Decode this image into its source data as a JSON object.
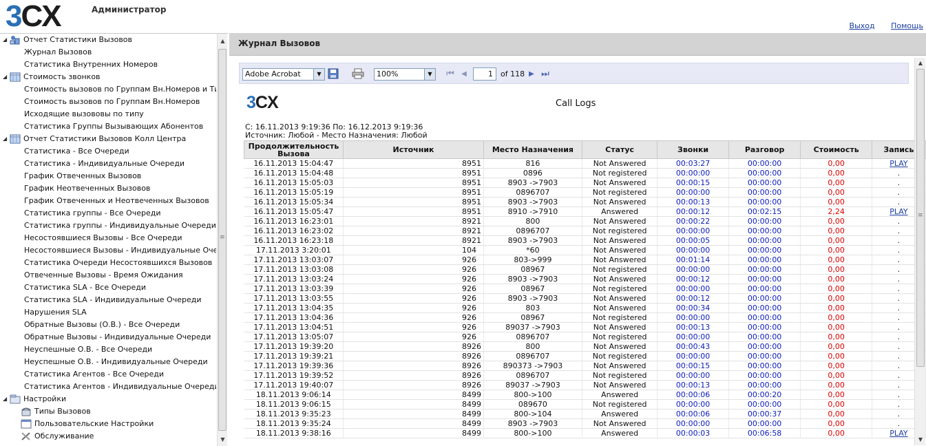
{
  "header": {
    "logo_3": "3",
    "logo_cx": "CX",
    "title": "Администратор",
    "logout": "Выход",
    "help": "Помощь"
  },
  "sidebar": {
    "items": [
      {
        "type": "group",
        "label": "Отчет Статистики Вызовов",
        "icon": "reports-icon"
      },
      {
        "type": "leaf",
        "label": "Журнал Вызовов"
      },
      {
        "type": "leaf",
        "label": "Статистика Внутренних Номеров"
      },
      {
        "type": "group",
        "label": "Стоимость звонков",
        "icon": "table-icon"
      },
      {
        "type": "leaf",
        "label": "Стоимость вызовов по Группам Вн.Номеров и Типам"
      },
      {
        "type": "leaf",
        "label": "Стоимость вызовов по Группам Вн.Номеров"
      },
      {
        "type": "leaf",
        "label": "Исходящие вызововы по типу"
      },
      {
        "type": "leaf",
        "label": "Статистика Группы Вызывающих Абонентов"
      },
      {
        "type": "group",
        "label": "Отчет Статистики Вызовов Колл Центра",
        "icon": "table-icon"
      },
      {
        "type": "leaf",
        "label": "Статистика - Все Очереди"
      },
      {
        "type": "leaf",
        "label": "Статистика - Индивидуальные Очереди"
      },
      {
        "type": "leaf",
        "label": "График Отвеченных Вызовов"
      },
      {
        "type": "leaf",
        "label": "График Неотвеченных Вызовов"
      },
      {
        "type": "leaf",
        "label": "График Отвеченных и Неотвеченных Вызовов"
      },
      {
        "type": "leaf",
        "label": "Статистика группы - Все Очереди"
      },
      {
        "type": "leaf",
        "label": "Статистика группы - Индивидуальные Очереди"
      },
      {
        "type": "leaf",
        "label": "Несостоявшиеся Вызовы - Все Очереди"
      },
      {
        "type": "leaf",
        "label": "Несостоявшиеся Вызовы - Индивидуальные Очереди"
      },
      {
        "type": "leaf",
        "label": "Статистика Очереди Несостоявшихся Вызовов"
      },
      {
        "type": "leaf",
        "label": "Отвеченные Вызовы - Время Ожидания"
      },
      {
        "type": "leaf",
        "label": "Статистика SLA - Все Очереди"
      },
      {
        "type": "leaf",
        "label": "Статистика SLA - Индивидуальные Очереди"
      },
      {
        "type": "leaf",
        "label": "Нарушения SLA"
      },
      {
        "type": "leaf",
        "label": "Обратные Вызовы (О.В.) - Все Очереди"
      },
      {
        "type": "leaf",
        "label": "Обратные Вызовы - Индивидуальные Очереди"
      },
      {
        "type": "leaf",
        "label": "Неуспешные О.В. - Все  Очереди"
      },
      {
        "type": "leaf",
        "label": "Неуспешные О.В. - Индивидуальные  Очереди"
      },
      {
        "type": "leaf",
        "label": "Статистика Агентов - Все Очереди"
      },
      {
        "type": "leaf",
        "label": "Статистика Агентов - Индивидуальные Очереди"
      },
      {
        "type": "group",
        "label": "Настройки",
        "icon": "settings-icon"
      },
      {
        "type": "subgroup",
        "label": "Типы Вызовов",
        "icon": "phone-icon"
      },
      {
        "type": "subgroup",
        "label": "Пользовательские Настройки",
        "icon": "window-icon"
      },
      {
        "type": "subgroup",
        "label": "Обслуживание",
        "icon": "tools-icon"
      }
    ]
  },
  "main": {
    "title": "Журнал Вызовов",
    "toolbar": {
      "format": "Adobe Acrobat",
      "zoom": "100%",
      "page": "1",
      "of_label": "of 118"
    },
    "report": {
      "title": "Call Logs",
      "range": "С: 16.11.2013 9:19:36 По: 16.12.2013 9:19:36",
      "filter": "Источник: Любой - Место Назначения: Любой",
      "columns": [
        "Продолжительность Вызова",
        "Источник",
        "Место Назначения",
        "Статус",
        "Звонки",
        "Разговор",
        "Стоимость",
        "Запись"
      ],
      "rows": [
        [
          "16.11.2013 15:04:47",
          "8951",
          "816",
          "Not Answered",
          "00:03:27",
          "00:00:00",
          "0,00",
          "PLAY"
        ],
        [
          "16.11.2013 15:04:48",
          "8951",
          "0896",
          "Not registered",
          "00:00:00",
          "00:00:00",
          "0,00",
          "."
        ],
        [
          "16.11.2013 15:05:03",
          "8951",
          "8903                    ->7903",
          "Not Answered",
          "00:00:15",
          "00:00:00",
          "0,00",
          "."
        ],
        [
          "16.11.2013 15:05:19",
          "8951",
          "0896707",
          "Not registered",
          "00:00:00",
          "00:00:00",
          "0,00",
          "."
        ],
        [
          "16.11.2013 15:05:34",
          "8951",
          "8903                    ->7903",
          "Not Answered",
          "00:00:13",
          "00:00:00",
          "0,00",
          "."
        ],
        [
          "16.11.2013 15:05:47",
          "8951",
          "8910                    ->7910",
          "Answered",
          "00:00:12",
          "00:02:15",
          "2,24",
          "PLAY"
        ],
        [
          "16.11.2013 16:23:01",
          "8921",
          "800",
          "Not Answered",
          "00:00:22",
          "00:00:00",
          "0,00",
          "."
        ],
        [
          "16.11.2013 16:23:02",
          "8921",
          "0896707",
          "Not registered",
          "00:00:00",
          "00:00:00",
          "0,00",
          "."
        ],
        [
          "16.11.2013 16:23:18",
          "8921",
          "8903                    ->7903",
          "Not Answered",
          "00:00:05",
          "00:00:00",
          "0,00",
          "."
        ],
        [
          "17.11.2013 3:20:01",
          "104",
          "*60",
          "Not Answered",
          "00:00:00",
          "00:00:00",
          "0,00",
          "."
        ],
        [
          "17.11.2013 13:03:07",
          "926",
          "803->999",
          "Not Answered",
          "00:01:14",
          "00:00:00",
          "0,00",
          "."
        ],
        [
          "17.11.2013 13:03:08",
          "926",
          "08967",
          "Not registered",
          "00:00:00",
          "00:00:00",
          "0,00",
          "."
        ],
        [
          "17.11.2013 13:03:24",
          "926",
          "8903                    ->7903",
          "Not Answered",
          "00:00:12",
          "00:00:00",
          "0,00",
          "."
        ],
        [
          "17.11.2013 13:03:39",
          "926",
          "08967",
          "Not registered",
          "00:00:00",
          "00:00:00",
          "0,00",
          "."
        ],
        [
          "17.11.2013 13:03:55",
          "926",
          "8903                    ->7903",
          "Not Answered",
          "00:00:12",
          "00:00:00",
          "0,00",
          "."
        ],
        [
          "17.11.2013 13:04:35",
          "926",
          "803",
          "Not Answered",
          "00:00:34",
          "00:00:00",
          "0,00",
          "."
        ],
        [
          "17.11.2013 13:04:36",
          "926",
          "08967",
          "Not registered",
          "00:00:00",
          "00:00:00",
          "0,00",
          "."
        ],
        [
          "17.11.2013 13:04:51",
          "926",
          "89037                    ->7903",
          "Not Answered",
          "00:00:13",
          "00:00:00",
          "0,00",
          "."
        ],
        [
          "17.11.2013 13:05:07",
          "926",
          "0896707",
          "Not registered",
          "00:00:00",
          "00:00:00",
          "0,00",
          "."
        ],
        [
          "17.11.2013 19:39:20",
          "8926",
          "800",
          "Not Answered",
          "00:00:43",
          "00:00:00",
          "0,00",
          "."
        ],
        [
          "17.11.2013 19:39:21",
          "8926",
          "0896707",
          "Not registered",
          "00:00:00",
          "00:00:00",
          "0,00",
          "."
        ],
        [
          "17.11.2013 19:39:36",
          "8926",
          "890373                  ->7903",
          "Not Answered",
          "00:00:15",
          "00:00:00",
          "0,00",
          "."
        ],
        [
          "17.11.2013 19:39:52",
          "8926",
          "0896707",
          "Not registered",
          "00:00:00",
          "00:00:00",
          "0,00",
          "."
        ],
        [
          "17.11.2013 19:40:07",
          "8926",
          "89037                    ->7903",
          "Not Answered",
          "00:00:13",
          "00:00:00",
          "0,00",
          "."
        ],
        [
          "18.11.2013 9:06:14",
          "8499",
          "800->100",
          "Answered",
          "00:00:06",
          "00:00:20",
          "0,00",
          "."
        ],
        [
          "18.11.2013 9:06:15",
          "8499",
          "089670",
          "Not registered",
          "00:00:00",
          "00:00:00",
          "0,00",
          "."
        ],
        [
          "18.11.2013 9:35:23",
          "8499",
          "800->104",
          "Answered",
          "00:00:06",
          "00:00:37",
          "0,00",
          "."
        ],
        [
          "18.11.2013 9:35:24",
          "8499",
          "8903                    ->7903",
          "Not Answered",
          "00:00:00",
          "00:00:00",
          "0,00",
          "."
        ],
        [
          "18.11.2013 9:38:16",
          "8499",
          "800->100",
          "Answered",
          "00:00:03",
          "00:06:58",
          "0,00",
          "PLAY"
        ]
      ]
    }
  }
}
